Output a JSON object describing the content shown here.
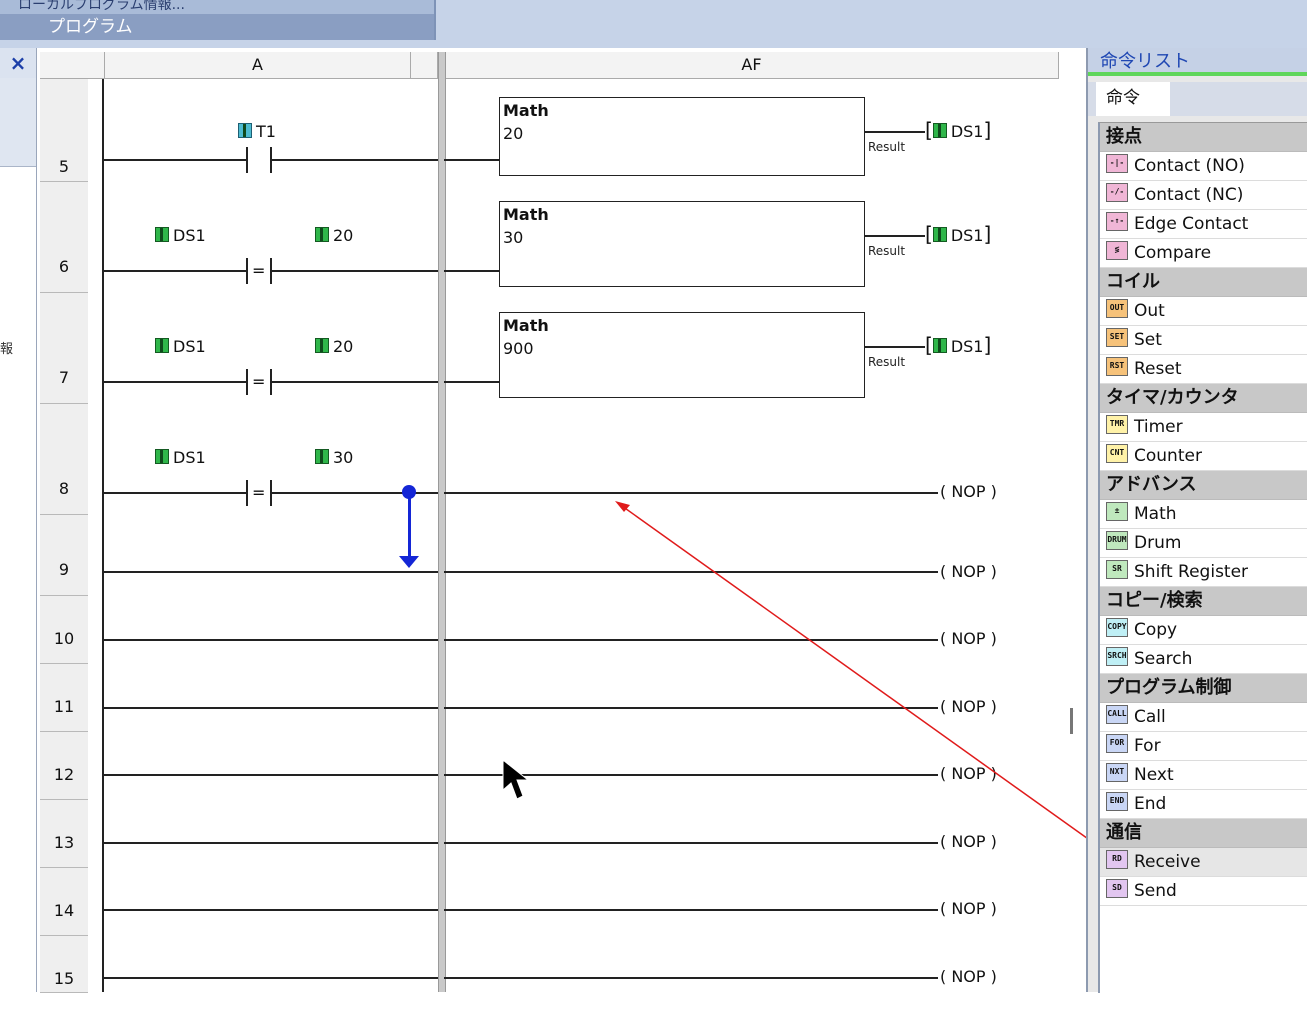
{
  "header": {
    "crumb": "ローカルプログラム情報...",
    "tab": "プログラム"
  },
  "left_panel": {
    "close": "×",
    "mark": "報"
  },
  "grid": {
    "columns": [
      "A",
      "AF"
    ],
    "rows": [
      "5",
      "6",
      "7",
      "8",
      "9",
      "10",
      "11",
      "12",
      "13",
      "14",
      "15"
    ]
  },
  "rungs": {
    "r5": {
      "contact": "T1",
      "math_title": "Math",
      "math_value": "20",
      "result": "Result",
      "coil": "DS1"
    },
    "r6": {
      "left": "DS1",
      "right": "20",
      "math_title": "Math",
      "math_value": "30",
      "result": "Result",
      "coil": "DS1"
    },
    "r7": {
      "left": "DS1",
      "right": "20",
      "math_title": "Math",
      "math_value": "900",
      "result": "Result",
      "coil": "DS1"
    },
    "r8": {
      "left": "DS1",
      "right": "30"
    },
    "eq": "=",
    "nop": "( NOP )"
  },
  "instruction_list": {
    "title": "命令リスト",
    "tab": "命令",
    "categories": [
      {
        "name": "接点",
        "items": [
          "Contact (NO)",
          "Contact (NC)",
          "Edge Contact",
          "Compare"
        ]
      },
      {
        "name": "コイル",
        "items": [
          "Out",
          "Set",
          "Reset"
        ]
      },
      {
        "name": "タイマ/カウンタ",
        "items": [
          "Timer",
          "Counter"
        ]
      },
      {
        "name": "アドバンス",
        "items": [
          "Math",
          "Drum",
          "Shift Register"
        ]
      },
      {
        "name": "コピー/検索",
        "items": [
          "Copy",
          "Search"
        ]
      },
      {
        "name": "プログラム制御",
        "items": [
          "Call",
          "For",
          "Next",
          "End"
        ]
      },
      {
        "name": "通信",
        "items": [
          "Receive",
          "Send"
        ]
      }
    ],
    "icons": {
      "Contact (NO)": "contact-no-icon",
      "Contact (NC)": "contact-nc-icon",
      "Edge Contact": "edge-contact-icon",
      "Compare": "compare-icon",
      "Out": "out-coil-icon",
      "Set": "set-coil-icon",
      "Reset": "reset-coil-icon",
      "Timer": "timer-icon",
      "Counter": "counter-icon",
      "Math": "math-icon",
      "Drum": "drum-icon",
      "Shift Register": "shift-register-icon",
      "Copy": "copy-icon",
      "Search": "search-icon",
      "Call": "call-icon",
      "For": "for-icon",
      "Next": "next-icon",
      "End": "end-icon",
      "Receive": "receive-icon",
      "Send": "send-icon"
    },
    "icon_labels": {
      "Contact (NO)": "-|-",
      "Contact (NC)": "-/-",
      "Edge Contact": "-↑-",
      "Compare": "≶",
      "Out": "OUT",
      "Set": "SET",
      "Reset": "RST",
      "Timer": "TMR",
      "Counter": "CNT",
      "Math": "±",
      "Drum": "DRUM",
      "Shift Register": "SR",
      "Copy": "COPY",
      "Search": "SRCH",
      "Call": "CALL",
      "For": "FOR",
      "Next": "NXT",
      "End": "END",
      "Receive": "RD",
      "Send": "SD"
    },
    "selected": "Receive"
  },
  "colors": {
    "accent_green": "#5fd65a",
    "drag_blue": "#1426d6",
    "drag_line_red": "#e01b1b",
    "title_blue": "#1f47b3"
  }
}
